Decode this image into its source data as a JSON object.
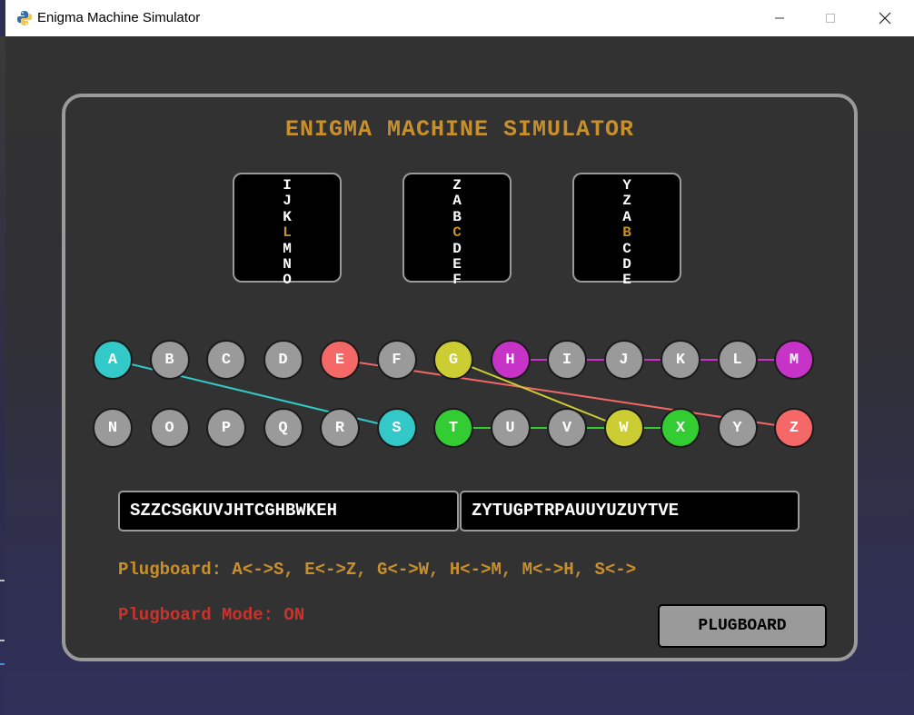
{
  "window": {
    "title": "Enigma Machine Simulator",
    "icon": "python-icon",
    "controls": [
      "minimize",
      "maximize",
      "close"
    ]
  },
  "app": {
    "heading": "ENIGMA MACHINE SIMULATOR",
    "colors": {
      "accent": "#c8902c",
      "mode": "#c8342c",
      "key_default": "#9a9a9a",
      "panel_border": "#9a9a9a"
    }
  },
  "rotors": [
    {
      "letters": [
        "I",
        "J",
        "K",
        "L",
        "M",
        "N",
        "O"
      ],
      "current": "L"
    },
    {
      "letters": [
        "Z",
        "A",
        "B",
        "C",
        "D",
        "E",
        "F"
      ],
      "current": "C"
    },
    {
      "letters": [
        "Y",
        "Z",
        "A",
        "B",
        "C",
        "D",
        "E"
      ],
      "current": "B"
    }
  ],
  "keyboard": {
    "rows": [
      [
        "A",
        "B",
        "C",
        "D",
        "E",
        "F",
        "G",
        "H",
        "I",
        "J",
        "K",
        "L",
        "M"
      ],
      [
        "N",
        "O",
        "P",
        "Q",
        "R",
        "S",
        "T",
        "U",
        "V",
        "W",
        "X",
        "Y",
        "Z"
      ]
    ],
    "key_colors": {
      "A": "#33c9c9",
      "S": "#33c9c9",
      "E": "#f56868",
      "Z": "#f56868",
      "G": "#cccc33",
      "W": "#cccc33",
      "H": "#c633c6",
      "M": "#c633c6",
      "T": "#33cc33",
      "X": "#33cc33"
    },
    "connections": [
      {
        "from": "A",
        "to": "S",
        "color": "#33c9c9"
      },
      {
        "from": "E",
        "to": "Z",
        "color": "#f56868"
      },
      {
        "from": "G",
        "to": "W",
        "color": "#cccc33"
      },
      {
        "from": "H",
        "to": "M",
        "color": "#c633c6"
      },
      {
        "from": "T",
        "to": "X",
        "color": "#33cc33"
      }
    ]
  },
  "input_text": "SZZCSGKUVJHTCGHBWKEH",
  "output_text": "ZYTUGPTRPAUUYUZUYTVE",
  "plugboard_list": "Plugboard: A<->S, E<->Z, G<->W, H<->M, M<->H, S<->",
  "plugboard_mode": "Plugboard Mode: ON",
  "plugboard_button": "PLUGBOARD"
}
